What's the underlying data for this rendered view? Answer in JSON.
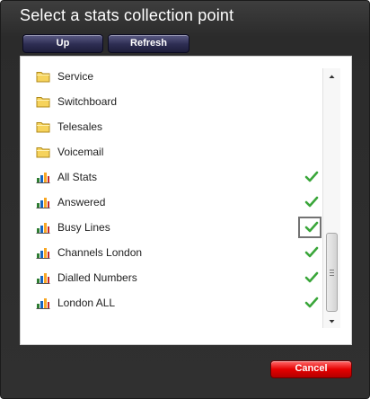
{
  "dialog": {
    "title": "Select a stats collection point",
    "up_label": "Up",
    "refresh_label": "Refresh",
    "cancel_label": "Cancel"
  },
  "colors": {
    "folder": "#f6d35c",
    "check": "#3aa63a",
    "cancel": "#e50000",
    "dark_button": "#2d2d52"
  },
  "list": {
    "folders": [
      {
        "label": "Service",
        "icon": "folder-icon"
      },
      {
        "label": "Switchboard",
        "icon": "folder-icon"
      },
      {
        "label": "Telesales",
        "icon": "folder-icon"
      },
      {
        "label": "Voicemail",
        "icon": "folder-icon"
      }
    ],
    "stats": [
      {
        "label": "All Stats",
        "icon": "stats-chart-icon",
        "checked": true
      },
      {
        "label": "Answered",
        "icon": "stats-chart-icon",
        "checked": true
      },
      {
        "label": "Busy Lines",
        "icon": "stats-chart-icon",
        "checked": true,
        "highlighted": true
      },
      {
        "label": "Channels London",
        "icon": "stats-chart-icon",
        "checked": true
      },
      {
        "label": "Dialled Numbers",
        "icon": "stats-chart-icon",
        "checked": true
      },
      {
        "label": "London ALL",
        "icon": "stats-chart-icon",
        "checked": true
      }
    ]
  }
}
